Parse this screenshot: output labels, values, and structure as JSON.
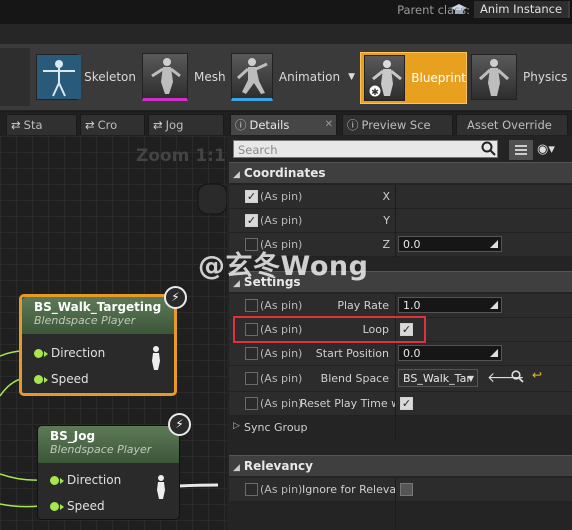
{
  "titlebar": {
    "help_icon": "graduation-cap-icon",
    "min": "—",
    "max": "❐",
    "close": "✕"
  },
  "parent_class": {
    "label": "Parent class:",
    "value": "Anim Instance"
  },
  "modes": [
    {
      "label": "Skeleton",
      "icon": "skeleton-icon"
    },
    {
      "label": "Mesh",
      "icon": "mesh-icon"
    },
    {
      "label": "Animation",
      "icon": "animation-icon",
      "dropdown": "▼"
    },
    {
      "label": "Blueprint",
      "icon": "blueprint-icon",
      "active": true
    },
    {
      "label": "Physics",
      "icon": "physics-icon"
    }
  ],
  "tabs": [
    {
      "label": "Sta"
    },
    {
      "label": "Cro"
    },
    {
      "label": "Jog"
    },
    {
      "label": "Details"
    },
    {
      "label": "Preview Sce"
    },
    {
      "label": "Asset Override"
    }
  ],
  "graph": {
    "zoom": "Zoom 1:1",
    "nodes": [
      {
        "title": "BS_Walk_Targeting",
        "subtitle": "Blendspace Player",
        "pins": [
          "Direction",
          "Speed"
        ],
        "selected": true
      },
      {
        "title": "BS_Jog",
        "subtitle": "Blendspace Player",
        "pins": [
          "Direction",
          "Speed"
        ],
        "selected": false
      }
    ]
  },
  "details": {
    "search_placeholder": "Search",
    "categories": {
      "coordinates": "Coordinates",
      "settings": "Settings",
      "relevancy": "Relevancy"
    },
    "pin_label": "(As pin)",
    "coordinates": [
      {
        "name": "X",
        "pin_checked": true,
        "value": ""
      },
      {
        "name": "Y",
        "pin_checked": true,
        "value": ""
      },
      {
        "name": "Z",
        "pin_checked": false,
        "value": "0.0"
      }
    ],
    "settings": {
      "play_rate": {
        "label": "Play Rate",
        "value": "1.0"
      },
      "loop": {
        "label": "Loop",
        "checked": true
      },
      "start_position": {
        "label": "Start Position",
        "value": "0.0"
      },
      "blend_space": {
        "label": "Blend Space",
        "value": "BS_Walk_Tar"
      },
      "reset_play_time": {
        "label": "Reset Play Time w",
        "checked": true
      },
      "sync_group": {
        "label": "Sync Group"
      }
    },
    "relevancy": {
      "ignore_for_relevancy": {
        "label": "Ignore for Relevanc",
        "checked": false
      }
    }
  },
  "watermark": "@玄冬Wong",
  "colors": {
    "accent": "#e8a11e",
    "node_pin": "#a6e84b",
    "highlight": "#e0303a"
  }
}
